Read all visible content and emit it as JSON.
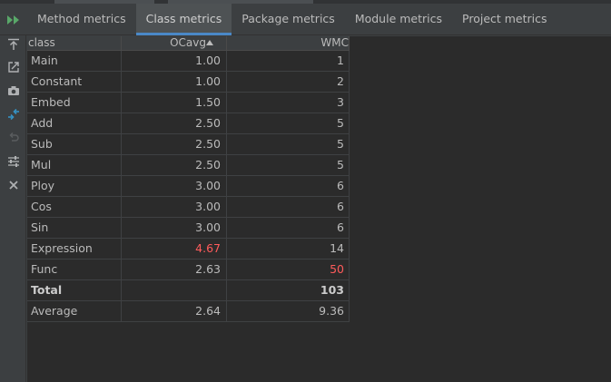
{
  "tabs": [
    {
      "label": "Method metrics",
      "active": false
    },
    {
      "label": "Class metrics",
      "active": true
    },
    {
      "label": "Package metrics",
      "active": false
    },
    {
      "label": "Module metrics",
      "active": false
    },
    {
      "label": "Project metrics",
      "active": false
    }
  ],
  "toolbar": {
    "icons": [
      "run-icon",
      "export-icon",
      "open-external-icon",
      "camera-icon",
      "diff-icon",
      "undo-icon",
      "settings-sliders-icon",
      "close-icon"
    ]
  },
  "table": {
    "columns": [
      "class",
      "OCavg",
      "WMC"
    ],
    "sorted_column": "OCavg",
    "rows": [
      {
        "class": "Main",
        "ocavg": "1.00",
        "wmc": "1",
        "ocavg_warn": false,
        "wmc_warn": false
      },
      {
        "class": "Constant",
        "ocavg": "1.00",
        "wmc": "2",
        "ocavg_warn": false,
        "wmc_warn": false
      },
      {
        "class": "Embed",
        "ocavg": "1.50",
        "wmc": "3",
        "ocavg_warn": false,
        "wmc_warn": false
      },
      {
        "class": "Add",
        "ocavg": "2.50",
        "wmc": "5",
        "ocavg_warn": false,
        "wmc_warn": false
      },
      {
        "class": "Sub",
        "ocavg": "2.50",
        "wmc": "5",
        "ocavg_warn": false,
        "wmc_warn": false
      },
      {
        "class": "Mul",
        "ocavg": "2.50",
        "wmc": "5",
        "ocavg_warn": false,
        "wmc_warn": false
      },
      {
        "class": "Ploy",
        "ocavg": "3.00",
        "wmc": "6",
        "ocavg_warn": false,
        "wmc_warn": false
      },
      {
        "class": "Cos",
        "ocavg": "3.00",
        "wmc": "6",
        "ocavg_warn": false,
        "wmc_warn": false
      },
      {
        "class": "Sin",
        "ocavg": "3.00",
        "wmc": "6",
        "ocavg_warn": false,
        "wmc_warn": false
      },
      {
        "class": "Expression",
        "ocavg": "4.67",
        "wmc": "14",
        "ocavg_warn": true,
        "wmc_warn": false
      },
      {
        "class": "Func",
        "ocavg": "2.63",
        "wmc": "50",
        "ocavg_warn": false,
        "wmc_warn": true
      }
    ],
    "total": {
      "class": "Total",
      "ocavg": "",
      "wmc": "103"
    },
    "average": {
      "class": "Average",
      "ocavg": "2.64",
      "wmc": "9.36"
    }
  },
  "colors": {
    "warning": "#ff5b5b",
    "accent": "#4a88c7",
    "run_green": "#59a869"
  }
}
